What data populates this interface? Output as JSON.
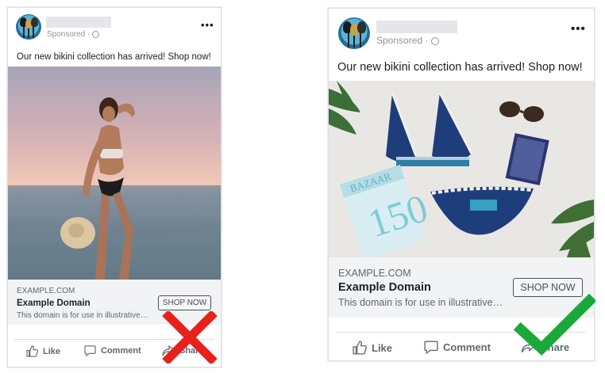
{
  "left_post": {
    "sponsored": "Sponsored · ",
    "caption": "Our new bikini collection has arrived! Shop now!",
    "link": {
      "domain": "EXAMPLE.COM",
      "title": "Example Domain",
      "description": "This domain is for use in illustrative…",
      "cta": "SHOP NOW"
    },
    "actions": {
      "like": "Like",
      "comment": "Comment",
      "share": "Share"
    },
    "verdict": "cross-mark-red"
  },
  "right_post": {
    "sponsored": "Sponsored · ",
    "caption": "Our new bikini collection has arrived! Shop now!",
    "link": {
      "domain": "EXAMPLE.COM",
      "title": "Example Domain",
      "description": "This domain is for use in illustrative…",
      "cta": "SHOP NOW"
    },
    "actions": {
      "like": "Like",
      "comment": "Comment",
      "share": "Share"
    },
    "verdict": "check-mark-green"
  },
  "colors": {
    "cross": "#e8211b",
    "check": "#1aa83a",
    "link_bg": "#f2f3f5"
  }
}
